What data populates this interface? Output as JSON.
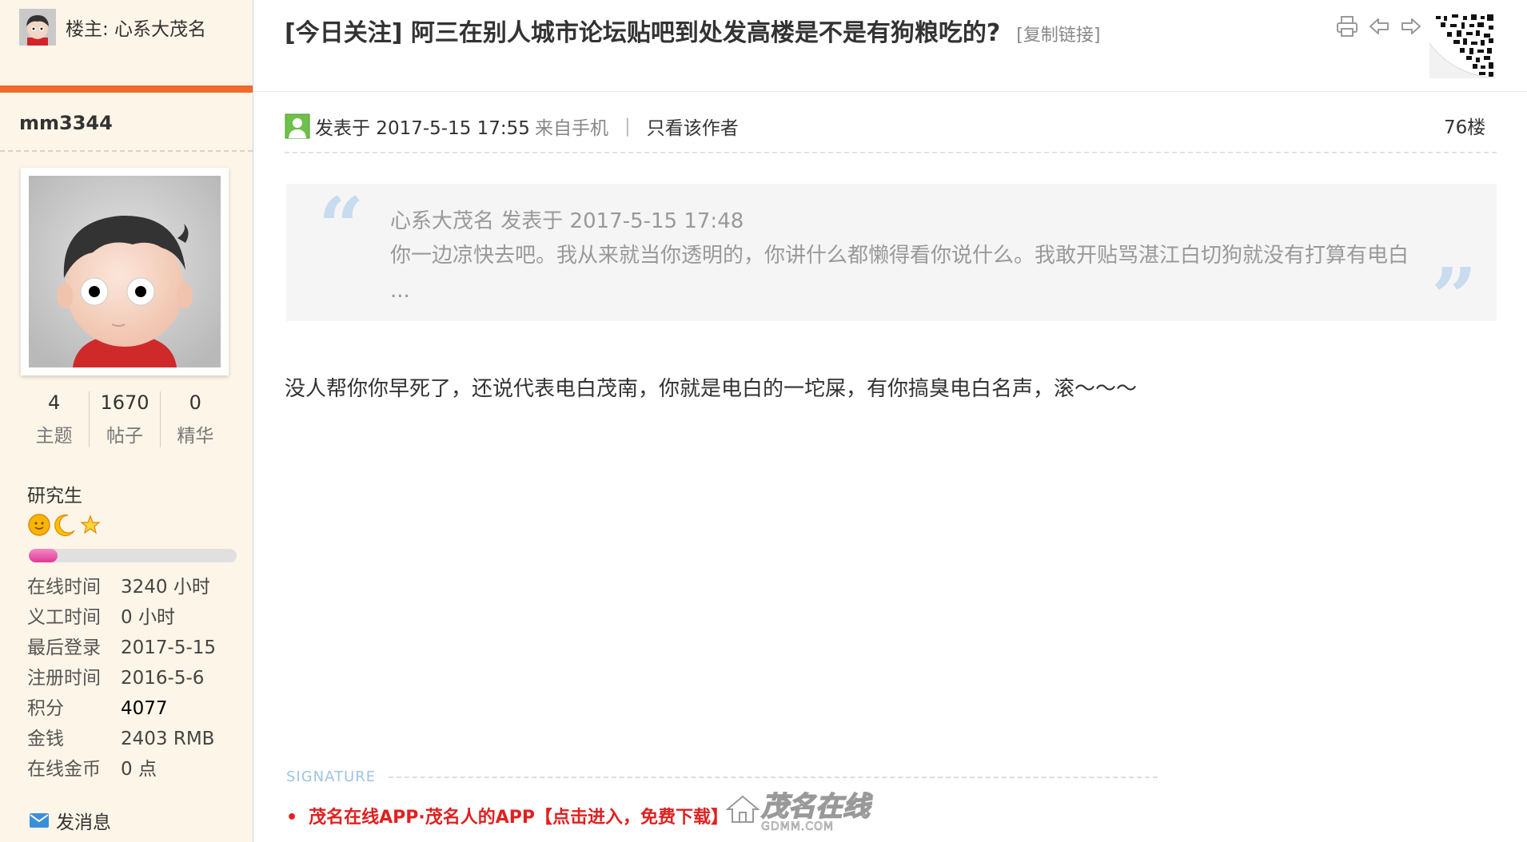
{
  "sidebar": {
    "op_label": "楼主: 心系大茂名",
    "username": "mm3344",
    "stats": [
      {
        "num": "4",
        "label": "主题"
      },
      {
        "num": "1670",
        "label": "帖子"
      },
      {
        "num": "0",
        "label": "精华"
      }
    ],
    "rank": "研究生",
    "rank_icons": [
      "sun-icon",
      "moon-icon",
      "star-icon"
    ],
    "level_progress": 0.14,
    "info": [
      {
        "k": "在线时间",
        "v": "3240 小时"
      },
      {
        "k": "义工时间",
        "v": "0 小时"
      },
      {
        "k": "最后登录",
        "v": "2017-5-15"
      },
      {
        "k": "注册时间",
        "v": "2016-5-6"
      },
      {
        "k": "积分",
        "v": "4077"
      },
      {
        "k": "金钱",
        "v": "2403 RMB"
      },
      {
        "k": "在线金币",
        "v": "0 点"
      }
    ],
    "send_message": "发消息"
  },
  "thread": {
    "title": "[今日关注] 阿三在别人城市论坛贴吧到处发高楼是不是有狗粮吃的?",
    "copy_link": "[复制链接]",
    "tools": [
      "print-icon",
      "prev-thread-icon",
      "next-thread-icon"
    ]
  },
  "post": {
    "posted": "发表于 2017-5-15 17:55",
    "from": "来自手机",
    "sep": "|",
    "only_author": "只看该作者",
    "floor": "76楼",
    "quote": {
      "header": "心系大茂名 发表于 2017-5-15 17:48",
      "body": "你一边凉快去吧。我从来就当你透明的，你讲什么都懒得看你说什么。我敢开贴骂湛江白切狗就没有打算有电白 ..."
    },
    "content": "没人帮你你早死了，还说代表电白茂南，你就是电白的一坨屎，有你搞臭电白名声，滚～～～",
    "signature_label": "SIGNATURE",
    "signature_item": "茂名在线APP·茂名人的APP【点击进入，免费下载】"
  },
  "watermark": {
    "name": "茂名在线",
    "url": "GDMM.COM"
  },
  "colors": {
    "accent": "#f26a2a",
    "sidebar_bg": "#fdf5e8",
    "signature_red": "#e02020",
    "progress": "#e0389a"
  }
}
